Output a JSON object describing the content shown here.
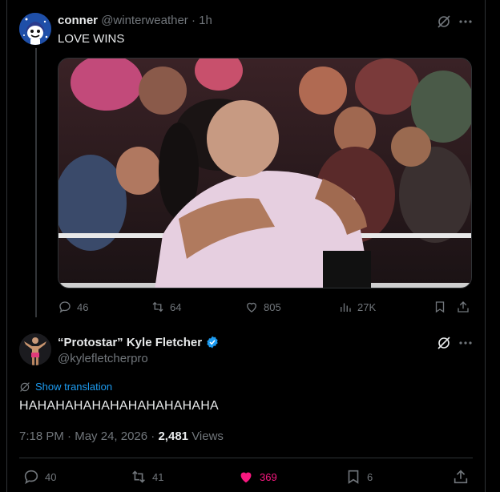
{
  "tweet1": {
    "display_name": "conner",
    "handle": "@winterweather",
    "separator": "·",
    "time": "1h",
    "text": "LOVE WINS",
    "image_alt": "Two people embracing in a wrestling ring in front of a crowd",
    "replies": "46",
    "reposts": "64",
    "likes": "805",
    "views": "27K"
  },
  "tweet2": {
    "display_name": "“Protostar” Kyle Fletcher",
    "handle": "@kylefletcherpro",
    "show_translation": "Show translation",
    "text": "HAHAHAHAHAHAHAHAHAHAHA",
    "time": "7:18 PM",
    "dot": "·",
    "date": "May 24, 2026",
    "dot2": "·",
    "views_count": "2,481",
    "views_label": "Views",
    "replies": "40",
    "reposts": "41",
    "likes": "369",
    "bookmarks": "6"
  },
  "colors": {
    "accent": "#1d9bf0",
    "like": "#f91880",
    "muted": "#71767b"
  },
  "icons": [
    "grok-icon",
    "more-icon",
    "reply-icon",
    "repost-icon",
    "like-icon",
    "views-icon",
    "bookmark-icon",
    "share-icon",
    "verified-icon",
    "translate-icon"
  ]
}
